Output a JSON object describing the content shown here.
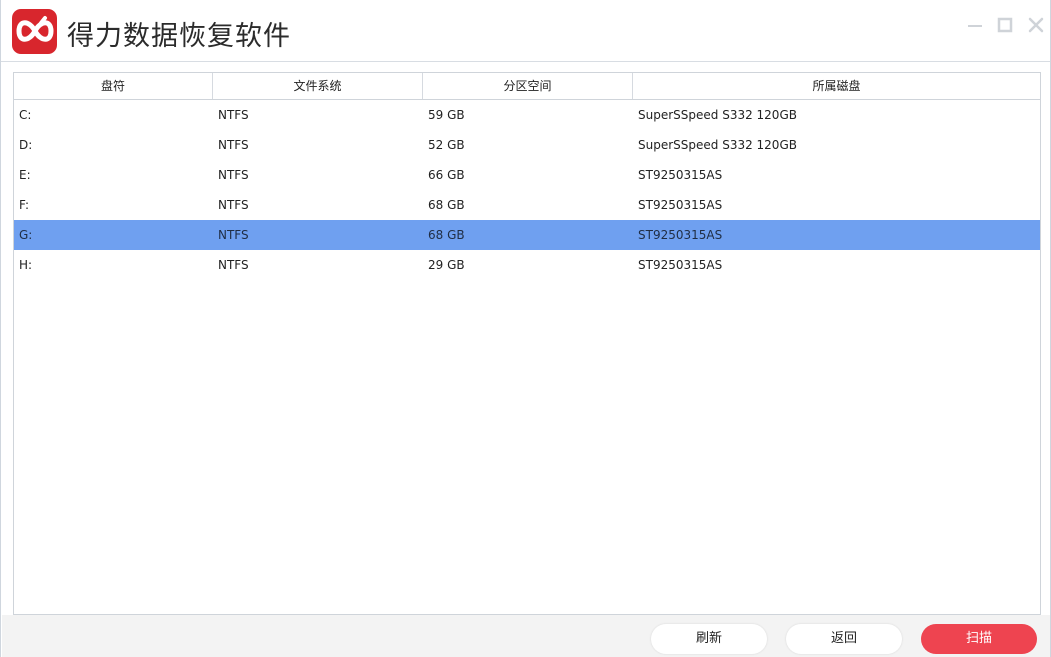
{
  "app": {
    "title": "得力数据恢复软件",
    "logo_icon": "infinity-logo-icon",
    "brand_color": "#d8262d"
  },
  "window_controls": {
    "minimize_icon": "minimize-icon",
    "maximize_icon": "maximize-icon",
    "close_icon": "close-icon"
  },
  "table": {
    "columns": [
      "盘符",
      "文件系统",
      "分区空间",
      "所属磁盘"
    ],
    "rows": [
      {
        "drive": "C:",
        "fs": "NTFS",
        "size": "59 GB",
        "disk": "SuperSSpeed S332 120GB",
        "selected": false
      },
      {
        "drive": "D:",
        "fs": "NTFS",
        "size": "52 GB",
        "disk": "SuperSSpeed S332 120GB",
        "selected": false
      },
      {
        "drive": "E:",
        "fs": "NTFS",
        "size": "66 GB",
        "disk": "ST9250315AS",
        "selected": false
      },
      {
        "drive": "F:",
        "fs": "NTFS",
        "size": "68 GB",
        "disk": "ST9250315AS",
        "selected": false
      },
      {
        "drive": "G:",
        "fs": "NTFS",
        "size": "68 GB",
        "disk": "ST9250315AS",
        "selected": true
      },
      {
        "drive": "H:",
        "fs": "NTFS",
        "size": "29 GB",
        "disk": "ST9250315AS",
        "selected": false
      }
    ],
    "selected_color": "#6fa0f0"
  },
  "footer": {
    "refresh_label": "刷新",
    "back_label": "返回",
    "scan_label": "扫描",
    "scan_color": "#ee4450"
  }
}
